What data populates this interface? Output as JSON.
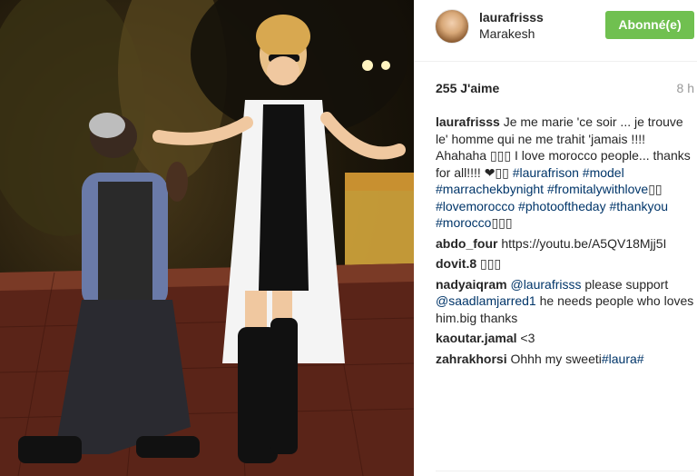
{
  "post": {
    "username": "laurafrisss",
    "location": "Marakesh",
    "follow_label": "Abonné(e)",
    "likes": "255 J'aime",
    "time": "8 h"
  },
  "caption": {
    "author": "laurafrisss",
    "text1": " Je me marie 'ce soir ... je trouve le' homme qui ne me trahit 'jamais !!!! Ahahaha ",
    "emoji1": "▯▯▯",
    "text2": " I love morocco people... thanks for all!!!! ",
    "heart": "❤",
    "emoji2": "▯▯",
    "tag1": " #laurafrison",
    "tag2": " #model",
    "tag3": "#marrachekbynight",
    "tag4": " #fromitalywithlove",
    "emoji3": "▯▯",
    "tag5": "#lovemorocco",
    "tag6": " #photooftheday",
    "tag7": " #thankyou",
    "tag8": "#morocco",
    "emoji4": "▯▯▯"
  },
  "comments": [
    {
      "author": "abdo_four",
      "text": " https://youtu.be/A5QV18Mjj5I"
    },
    {
      "author": "dovit.8",
      "text": " ▯▯▯"
    },
    {
      "author": "nadyaiqram",
      "mention1": " @laurafrisss",
      "text1": " please support ",
      "mention2": "@saadlamjarred1",
      "text2": " he needs people who loves him.big thanks"
    },
    {
      "author": "kaoutar.jamal",
      "text": " <3"
    },
    {
      "author": "zahrakhorsi",
      "text": " Ohhh my sweeti",
      "tag": "#laura#"
    }
  ]
}
